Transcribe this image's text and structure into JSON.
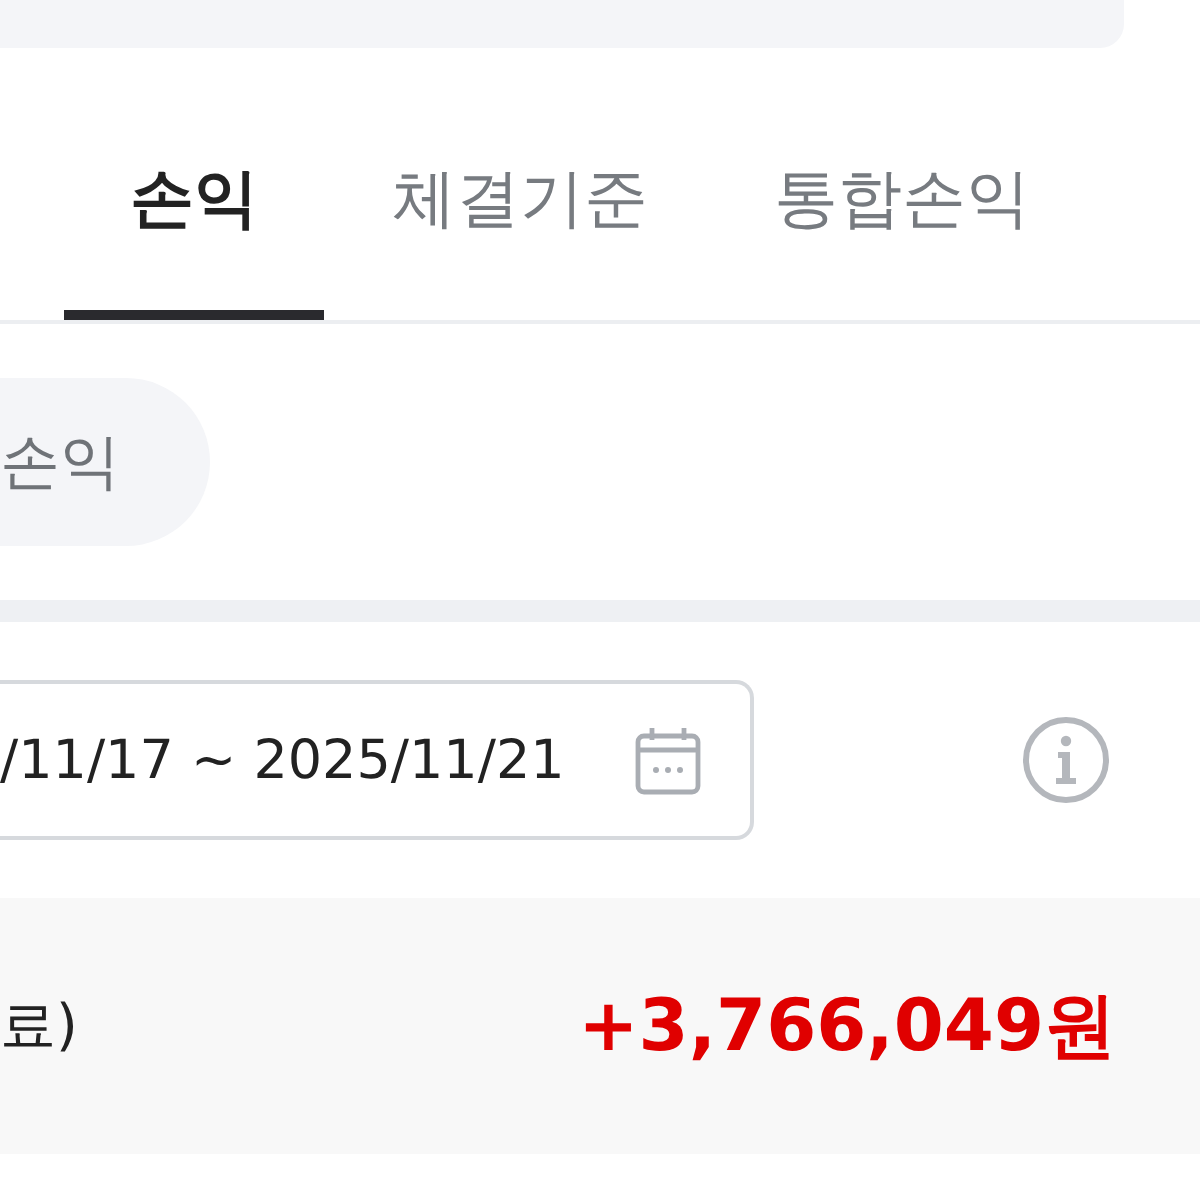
{
  "tabs": [
    {
      "label": "손익",
      "selected": true
    },
    {
      "label": "체결기준",
      "selected": false
    },
    {
      "label": "통합손익",
      "selected": false
    }
  ],
  "filter_chip": {
    "label": "손익"
  },
  "date_range": {
    "value": "/11/17 ~ 2025/11/21"
  },
  "summary": {
    "label": "료)",
    "amount": "+3,766,049원"
  }
}
